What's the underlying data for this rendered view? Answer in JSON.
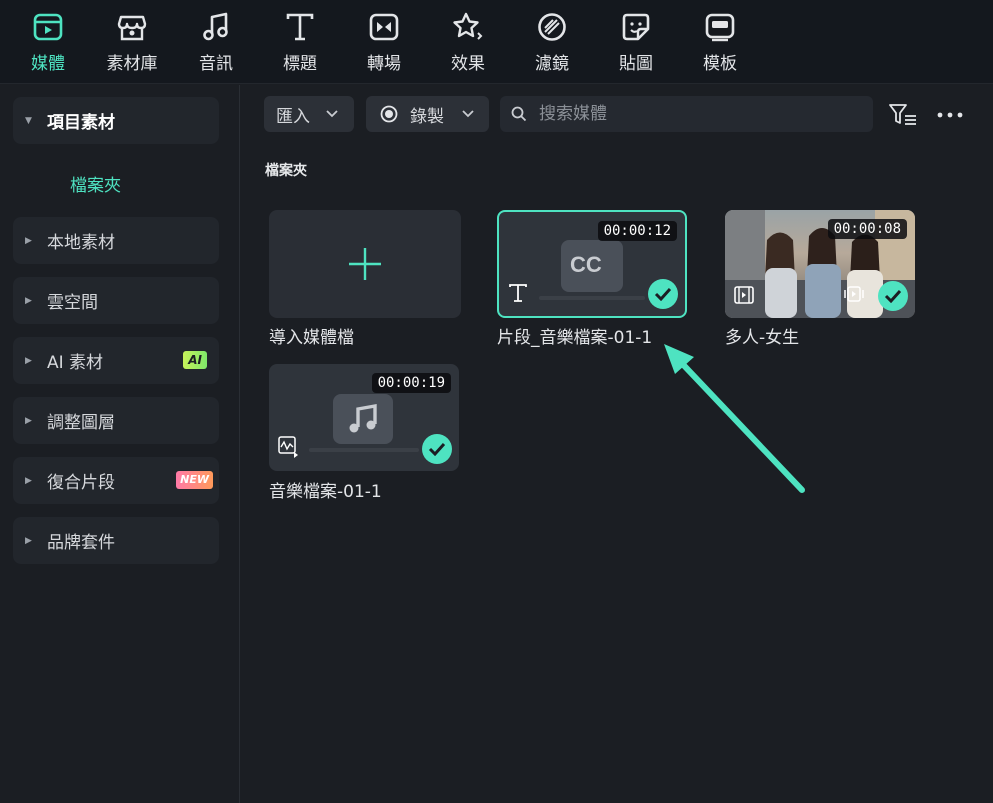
{
  "toolbar": {
    "items": [
      {
        "label": "媒體",
        "icon": "media-icon",
        "active": true
      },
      {
        "label": "素材庫",
        "icon": "stock-store-icon",
        "active": false
      },
      {
        "label": "音訊",
        "icon": "music-note-icon",
        "active": false
      },
      {
        "label": "標題",
        "icon": "text-t-icon",
        "active": false
      },
      {
        "label": "轉場",
        "icon": "transition-icon",
        "active": false
      },
      {
        "label": "效果",
        "icon": "effects-star-icon",
        "active": false
      },
      {
        "label": "濾鏡",
        "icon": "filter-icon",
        "active": false
      },
      {
        "label": "貼圖",
        "icon": "sticker-icon",
        "active": false
      },
      {
        "label": "模板",
        "icon": "template-icon",
        "active": false
      }
    ],
    "accent_color": "#4ee3c1"
  },
  "sidebar": {
    "items": [
      {
        "label": "項目素材",
        "expanded": true
      },
      {
        "label": "本地素材"
      },
      {
        "label": "雲空間"
      },
      {
        "label": "AI 素材",
        "badge": "AI"
      },
      {
        "label": "調整圖層"
      },
      {
        "label": "復合片段",
        "badge": "NEW"
      },
      {
        "label": "品牌套件"
      }
    ],
    "sub_item": "檔案夾"
  },
  "main": {
    "import_label": "匯入",
    "record_label": "錄製",
    "search_placeholder": "搜索媒體",
    "folder_title": "檔案夾",
    "cards": [
      {
        "name": "導入媒體檔",
        "type": "import"
      },
      {
        "name": "片段_音樂檔案-01-1",
        "type": "caption",
        "duration": "00:00:12",
        "selected": true,
        "added": true
      },
      {
        "name": "多人-女生",
        "type": "video",
        "duration": "00:00:08",
        "added": true
      },
      {
        "name": "音樂檔案-01-1",
        "type": "audio",
        "duration": "00:00:19",
        "added": true
      }
    ]
  }
}
